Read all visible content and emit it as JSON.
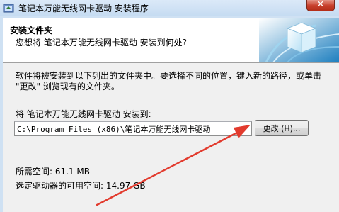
{
  "window": {
    "title": "笔记本万能无线网卡驱动 安装程序",
    "close_label": "✕"
  },
  "header": {
    "title": "安装文件夹",
    "subtitle": "您想将 笔记本万能无线网卡驱动 安装到何处?"
  },
  "body": {
    "description": "软件将被安装到以下列出的文件夹中。要选择不同的位置，键入新的路径，或单击 \"更改\" 浏览现有的文件夹。",
    "install_label": "将 笔记本万能无线网卡驱动 安装到:",
    "path_value": "C:\\Program Files (x86)\\笔记本万能无线网卡驱动",
    "browse_label": "更改 (H)...",
    "space_required": "所需空间: 61.1 MB",
    "space_available": "选定驱动器的可用空间: 14.97 GB"
  },
  "colors": {
    "arrow": "#e23b2e",
    "header_bg": "#ffffff",
    "client_bg": "#f0f0f0"
  },
  "icons": {
    "title": "installer-icon",
    "header": "globe-box-icon",
    "annotation": "red-arrow-icon"
  }
}
